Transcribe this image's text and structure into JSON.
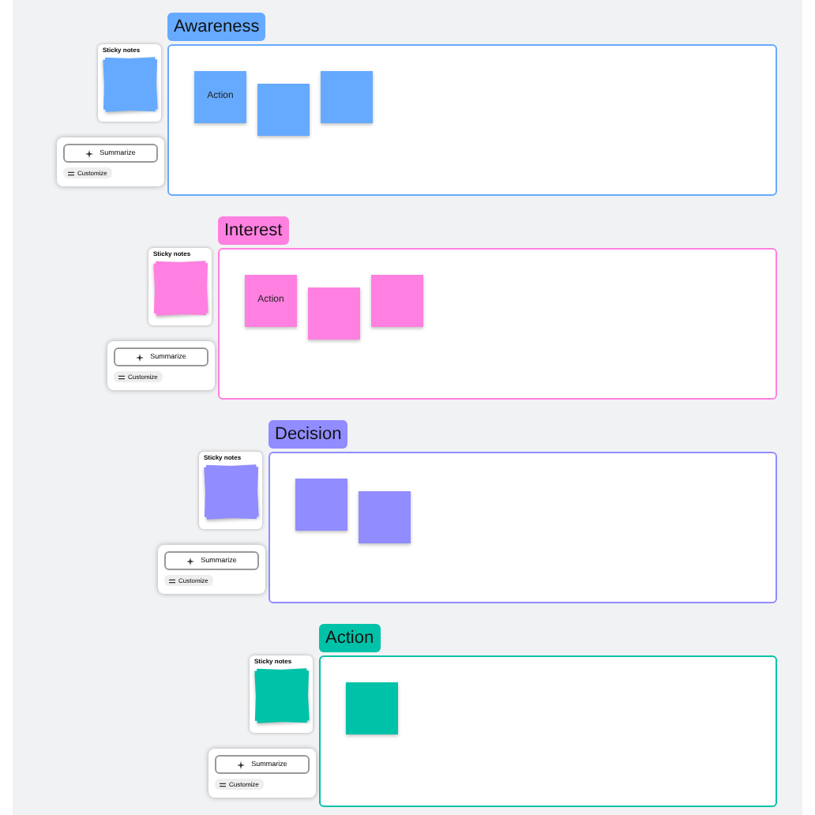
{
  "sections": [
    {
      "label": "Awareness",
      "color": "#66aaff",
      "panel_title": "Sticky notes",
      "summarize": "Summarize",
      "customize": "Customize",
      "notes": [
        {
          "kind": "text",
          "text": "Action"
        },
        {
          "kind": "blank"
        },
        {
          "kind": "blank"
        }
      ]
    },
    {
      "label": "Interest",
      "color": "#ff80e0",
      "panel_title": "Sticky notes",
      "summarize": "Summarize",
      "customize": "Customize",
      "notes": [
        {
          "kind": "text",
          "text": "Action"
        },
        {
          "kind": "blank"
        },
        {
          "kind": "blank"
        }
      ]
    },
    {
      "label": "Decision",
      "color": "#918cff",
      "panel_title": "Sticky notes",
      "summarize": "Summarize",
      "customize": "Customize",
      "notes": [
        {
          "kind": "blank"
        },
        {
          "kind": "blank"
        }
      ]
    },
    {
      "label": "Action",
      "color": "#00c2a8",
      "panel_title": "Sticky notes",
      "summarize": "Summarize",
      "customize": "Customize",
      "notes": [
        {
          "kind": "blank"
        }
      ]
    }
  ]
}
